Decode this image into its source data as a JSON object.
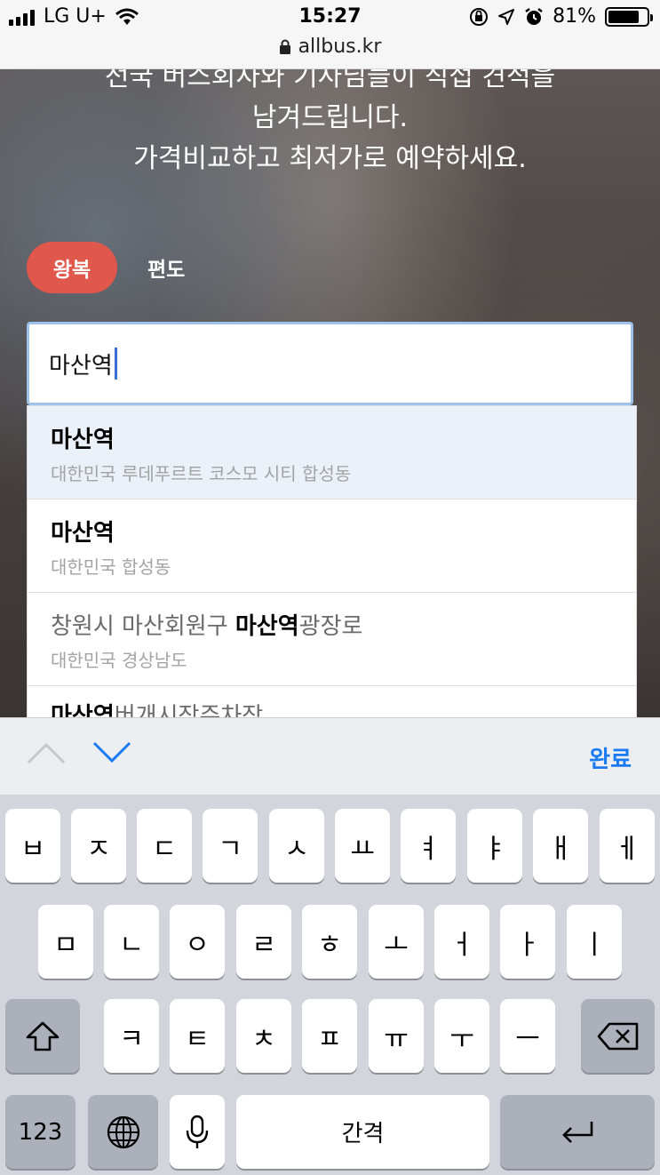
{
  "status_bar": {
    "carrier": "LG U+",
    "time": "15:27",
    "battery": "81%",
    "battery_level": 0.81,
    "url": "allbus.kr",
    "icons": [
      "signal-icon",
      "wifi-icon",
      "orientation-lock-icon",
      "location-icon",
      "alarm-icon",
      "battery-icon",
      "lock-icon"
    ]
  },
  "hero": {
    "line1": "전국 버스회사와 기사님들이 직접 견적을",
    "line2": "남겨드립니다.",
    "line3": "가격비교하고 최저가로 예약하세요."
  },
  "trip_tabs": {
    "round_trip": "왕복",
    "one_way": "편도",
    "active_color": "#e0574b"
  },
  "search": {
    "value": "마산역"
  },
  "suggestions": [
    {
      "prefix": "",
      "match": "마산역",
      "suffix": "",
      "secondary": "대한민국 루데푸르트 코스모 시티 합성동"
    },
    {
      "prefix": "",
      "match": "마산역",
      "suffix": "",
      "secondary": "대한민국 합성동"
    },
    {
      "prefix": "창원시 마산회원구 ",
      "match": "마산역",
      "suffix": "광장로",
      "secondary": "대한민국 경상남도"
    },
    {
      "prefix": "",
      "match": "마산역",
      "suffix": "버개시장주차장",
      "secondary": ""
    }
  ],
  "accessory": {
    "done_label": "완료",
    "accent": "#1a7af2"
  },
  "keyboard": {
    "row1": [
      "ㅂ",
      "ㅈ",
      "ㄷ",
      "ㄱ",
      "ㅅ",
      "ㅛ",
      "ㅕ",
      "ㅑ",
      "ㅐ",
      "ㅔ"
    ],
    "row2": [
      "ㅁ",
      "ㄴ",
      "ㅇ",
      "ㄹ",
      "ㅎ",
      "ㅗ",
      "ㅓ",
      "ㅏ",
      "ㅣ"
    ],
    "row3": [
      "ㅋ",
      "ㅌ",
      "ㅊ",
      "ㅍ",
      "ㅠ",
      "ㅜ",
      "ㅡ"
    ],
    "numbers_label": "123",
    "space_label": "간격"
  }
}
